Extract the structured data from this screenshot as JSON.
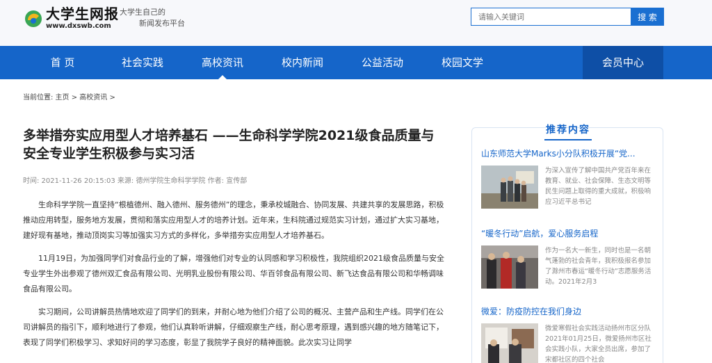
{
  "header": {
    "logo_cn": "大学生网报",
    "logo_url": "www.dxswb.com",
    "slogan_line1": "大学生自己的",
    "slogan_line2": "新闻发布平台",
    "search_placeholder": "请输入关键词",
    "search_button": "搜 索"
  },
  "nav": {
    "items": [
      {
        "label": "首 页"
      },
      {
        "label": "社会实践"
      },
      {
        "label": "高校资讯"
      },
      {
        "label": "校内新闻"
      },
      {
        "label": "公益活动"
      },
      {
        "label": "校园文学"
      }
    ],
    "member": "会员中心"
  },
  "breadcrumb": "当前位置: 主页 > 高校资讯 >",
  "article": {
    "title": "多举措夯实应用型人才培养基石 ——生命科学学院2021级食品质量与安全专业学生积极参与实习活",
    "meta": "时间: 2021-11-26 20:15:03 来源: 德州学院生命科学学院 作者: 宣传部",
    "paragraphs": [
      "生命科学学院一直坚持“根植德州、融入德州、服务德州”的理念，秉承校城融合、协同发展、共建共享的发展思路，积极推动应用转型，服务地方发展，贯彻和落实应用型人才的培养计划。近年来，生科院通过规范实习计划，通过扩大实习基地，建好现有基地，推动顶岗实习等加强实习方式的多样化，多举措夯实应用型人才培养基石。",
      "11月19日，为加强同学们对食品行业的了解，增强他们对专业的认同感和学习积极性，我院组织2021级食品质量与安全专业学生外出参观了德州双汇食品有限公司、光明乳业股份有限公司、华百邻食品有限公司、新飞达食品有限公司和华畅调味食品有限公司。",
      "实习期间，公司讲解员热情地欢迎了同学们的到来，并耐心地为他们介绍了公司的概况、主营产品和生产线。同学们在公司讲解员的指引下，顺利地进行了参观，他们认真聆听讲解，仔细观察生产线，耐心思考原理，遇到感兴趣的地方随笔记下，表现了同学们积极学习、求知好问的学习态度，彰显了我院学子良好的精神面貌。此次实习让同学"
    ]
  },
  "sidebar": {
    "title": "推荐内容",
    "items": [
      {
        "title": "山东师范大学Marks小分队积极开展“党...",
        "desc": "为深入宣传了解中国共产党百年来在教育、就业、社会保障、生态文明等民生问题上取得的重大成就，积极响应习近平总书记"
      },
      {
        "title": "“暖冬行动”启航，爱心服务启程",
        "desc": "作为一名大一新生，同时也是一名朝气蓬勃的社会青年，我积极报名参加了滁州市春运“暖冬行动”志愿服务活动。2021年2月3"
      },
      {
        "title": "微爱：防疫防控在我们身边",
        "desc": "微爱寒假社会实践活动扬州市区分队2021年01月25日，微爱扬州市区社会实践小队，大家全员出席，参加了宋都社区的四个社会"
      }
    ]
  },
  "colors": {
    "primary": "#1565c9",
    "member_bg": "#0e4fa6",
    "header_bg": "#f7f8fb"
  }
}
